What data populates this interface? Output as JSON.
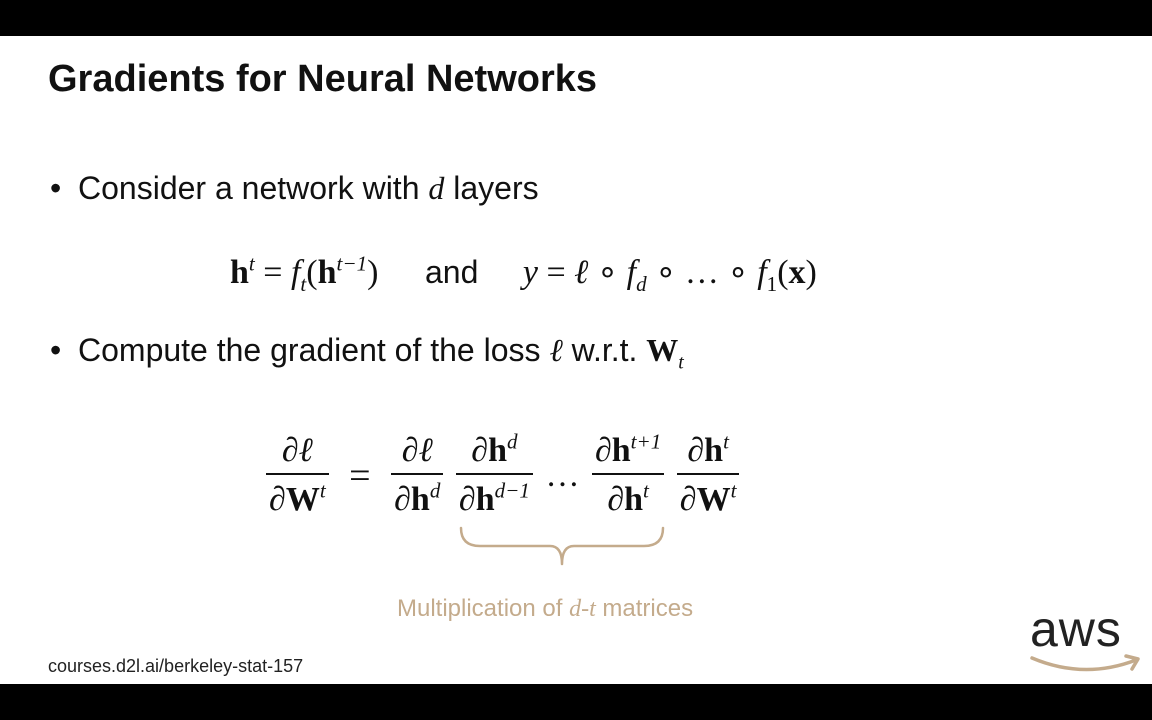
{
  "slide": {
    "title": "Gradients for Neural Networks",
    "bullets": [
      {
        "marker": "•",
        "text_before": "Consider a network with ",
        "var": "d",
        "text_after": " layers"
      },
      {
        "marker": "•",
        "text_before": "Compute the gradient of the loss ",
        "var": "ℓ",
        "text_middle": " w.r.t. ",
        "bold_var": "W",
        "sub": "t"
      }
    ],
    "formula1": {
      "h": "h",
      "t": "t",
      "eq": "=",
      "f": "f",
      "lp": "(",
      "rp": ")",
      "tm1": "t−1",
      "and": "and",
      "y": "y",
      "ell": "ℓ",
      "circ": "∘",
      "d": "d",
      "dots": "…",
      "one": "1",
      "x": "x"
    },
    "formula2": {
      "partial": "∂",
      "ell": "ℓ",
      "W": "W",
      "h": "h",
      "t": "t",
      "d": "d",
      "dm1": "d−1",
      "tp1": "t+1",
      "eq": "=",
      "dots": "…"
    },
    "brace_caption": {
      "before": "Multiplication of ",
      "var": "d-t",
      "after": " matrices"
    },
    "footer": "courses.d2l.ai/berkeley-stat-157",
    "logo": {
      "text": "aws",
      "icon": "amazon-smile-icon"
    }
  },
  "colors": {
    "text": "#111111",
    "caption": "#c4ab8c",
    "brace": "#c4ab8c",
    "logo_arrow": "#c4ab8c",
    "background": "#ffffff",
    "letterbox": "#000000"
  }
}
